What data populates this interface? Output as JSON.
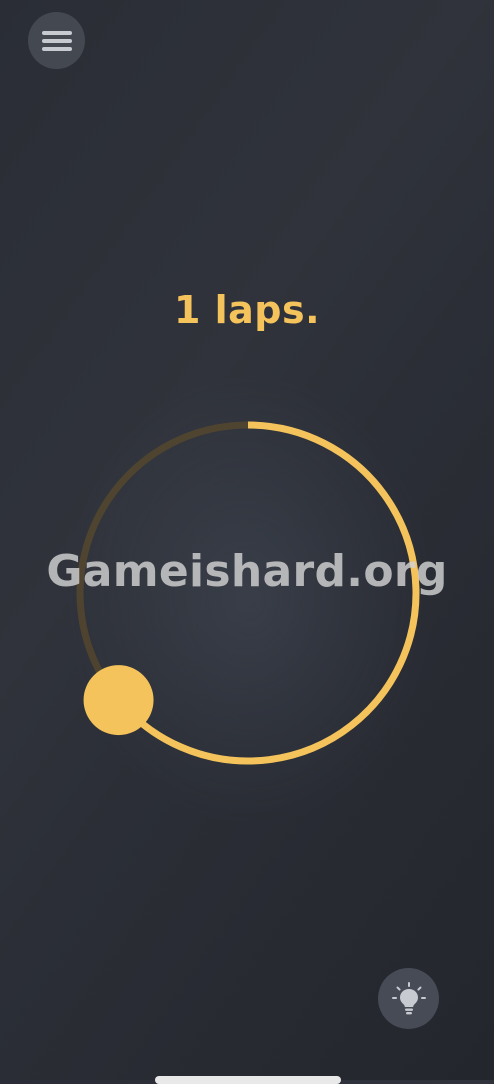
{
  "game": {
    "status_text": "1 laps.",
    "laps": 1,
    "lap_progress": 0.64,
    "accent_color": "#f5c35b",
    "track_dim_color": "#5a4a2c"
  },
  "watermark": {
    "text": "Gameishard.org"
  },
  "icons": {
    "menu": "hamburger-menu-icon",
    "hint": "lightbulb-icon"
  }
}
